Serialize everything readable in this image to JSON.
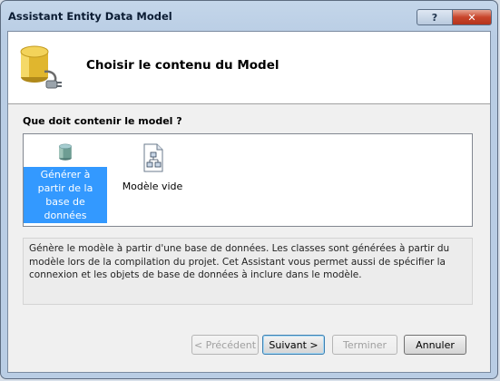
{
  "window": {
    "title": "Assistant Entity Data Model",
    "help_glyph": "?",
    "close_glyph": "✕"
  },
  "header": {
    "title": "Choisir le contenu du Model",
    "icon": "database-plug-icon"
  },
  "question": "Que doit contenir le model ?",
  "options": [
    {
      "label": "Générer à partir de la base de données",
      "icon": "database-icon",
      "selected": true
    },
    {
      "label": "Modèle vide",
      "icon": "empty-model-icon",
      "selected": false
    }
  ],
  "description": "Génère le modèle à partir d'une base de données. Les classes sont générées à partir du modèle lors de la compilation du projet. Cet Assistant vous permet aussi de spécifier la connexion et les objets de base de données à inclure dans le modèle.",
  "buttons": {
    "previous": "< Précédent",
    "next": "Suivant >",
    "finish": "Terminer",
    "cancel": "Annuler"
  },
  "colors": {
    "selection": "#3399ff",
    "close_button": "#c8452b"
  }
}
